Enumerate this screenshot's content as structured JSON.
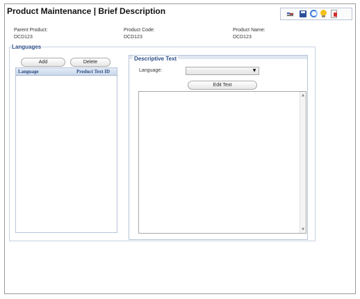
{
  "header": {
    "title": "Product Maintenance | Brief Description"
  },
  "toolbar": {
    "icons": [
      "flag-icon",
      "save-icon",
      "refresh-icon",
      "lightbulb-icon",
      "document-icon"
    ]
  },
  "info": {
    "parent_product": {
      "label": "Parent Product:",
      "value": "DCD123"
    },
    "product_code": {
      "label": "Product Code:",
      "value": "DCD123"
    },
    "product_name": {
      "label": "Product Name:",
      "value": "DCD123"
    }
  },
  "languages": {
    "group_label": "Languages",
    "add_label": "Add",
    "delete_label": "Delete",
    "columns": [
      "Language",
      "Product Text ID"
    ],
    "rows": []
  },
  "descriptive_text": {
    "group_label": "Descriptive Text",
    "language_label": "Language:",
    "language_value": "",
    "edit_label": "Edit Text",
    "text_value": ""
  },
  "colors": {
    "accent": "#2b4c86",
    "border": "#9a9a9a",
    "header_gradient_top": "#e4ecf7",
    "header_gradient_bottom": "#c9d7ea"
  }
}
